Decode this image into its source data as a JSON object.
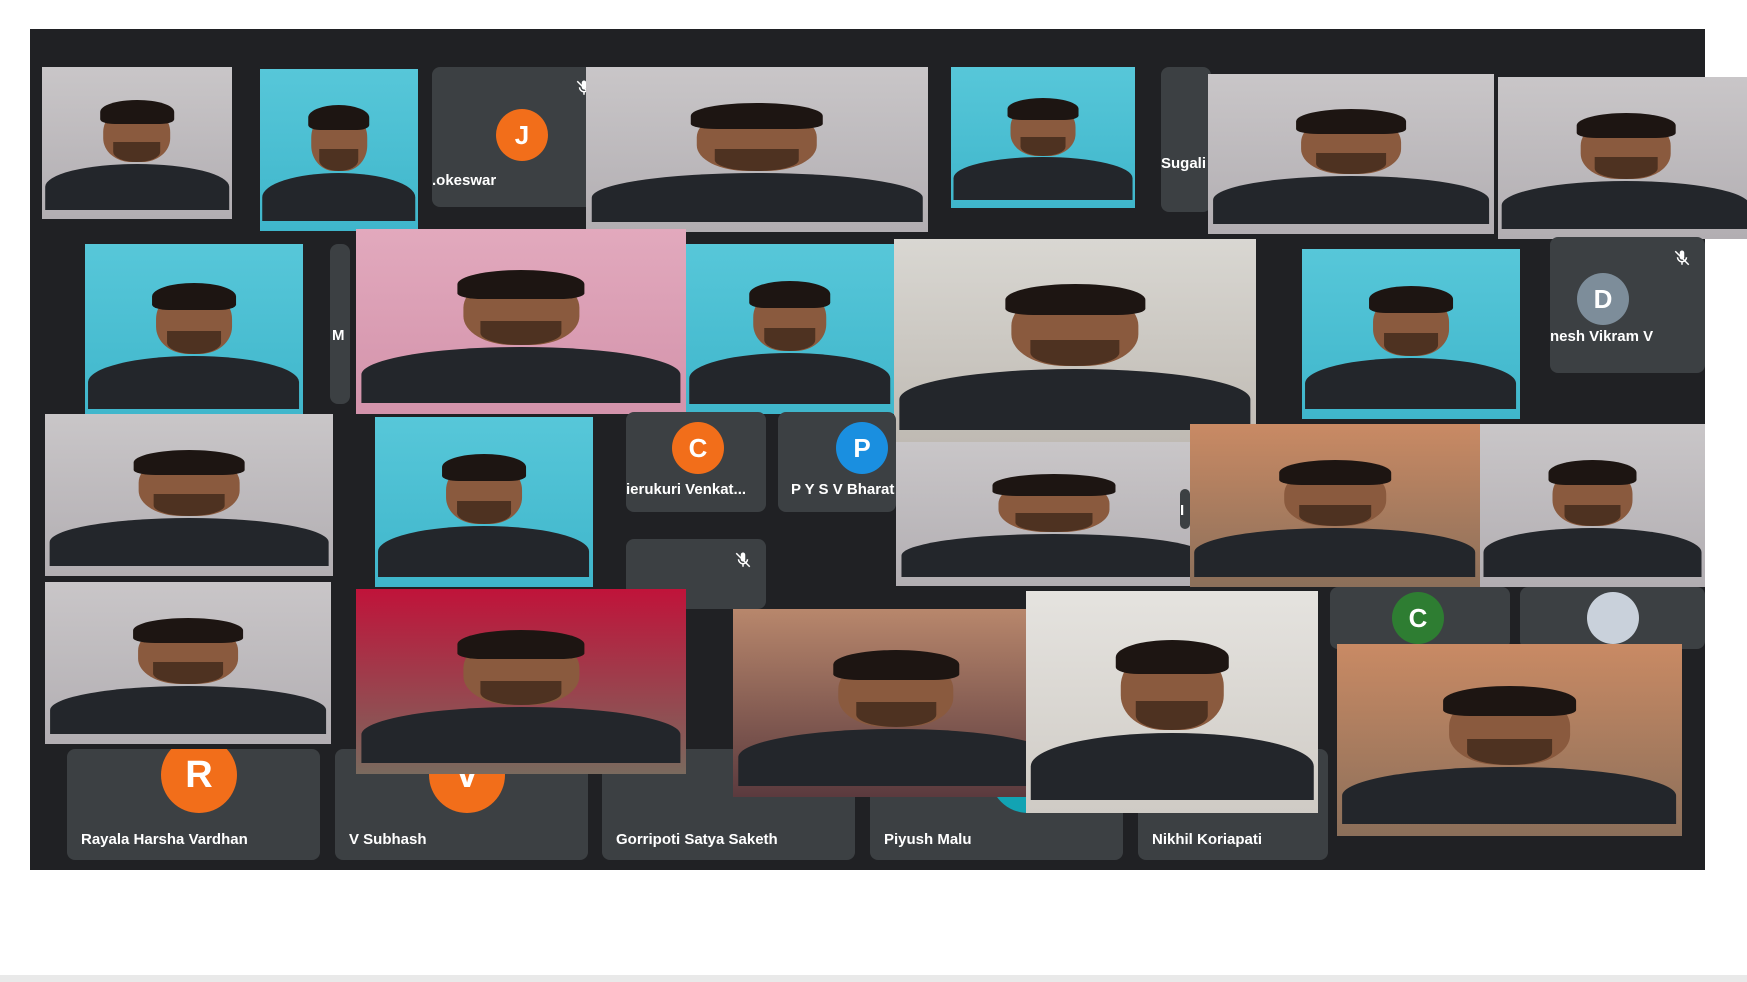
{
  "meeting": {
    "participants": [
      {
        "id": "p1",
        "name": "",
        "kind": "video",
        "theme": "wall"
      },
      {
        "id": "p2",
        "name": "",
        "kind": "video",
        "theme": "cyan"
      },
      {
        "id": "p3",
        "name": ".okeswar",
        "kind": "avatar",
        "initial": "J",
        "avatar_color": "#f26e1a",
        "muted": true
      },
      {
        "id": "p4",
        "name": "",
        "kind": "video",
        "theme": "wall"
      },
      {
        "id": "p5",
        "name": "",
        "kind": "video",
        "theme": "cyan"
      },
      {
        "id": "p6",
        "name": "Sugali",
        "kind": "label"
      },
      {
        "id": "p7",
        "name": "",
        "kind": "video",
        "theme": "wall"
      },
      {
        "id": "p8",
        "name": "",
        "kind": "video",
        "theme": "wall"
      },
      {
        "id": "p9",
        "name": "",
        "kind": "video",
        "theme": "cyan"
      },
      {
        "id": "p10",
        "name": "M",
        "kind": "label"
      },
      {
        "id": "p11",
        "name": "",
        "kind": "video",
        "theme": "pink"
      },
      {
        "id": "p12",
        "name": "",
        "kind": "video",
        "theme": "cyan"
      },
      {
        "id": "p13",
        "name": "",
        "kind": "video",
        "theme": "room"
      },
      {
        "id": "p14",
        "name": "",
        "kind": "video",
        "theme": "cyan"
      },
      {
        "id": "p15",
        "name": "nesh Vikram V",
        "kind": "avatar",
        "initial": "D",
        "avatar_color": "#7d8d9a",
        "muted": true
      },
      {
        "id": "p16",
        "name": "",
        "kind": "video",
        "theme": "wall"
      },
      {
        "id": "p17",
        "name": "",
        "kind": "video",
        "theme": "cyan"
      },
      {
        "id": "p18",
        "name": "ierukuri Venkat...",
        "kind": "avatar",
        "initial": "C",
        "avatar_color": "#f26e1a",
        "muted": false
      },
      {
        "id": "p19",
        "name": "P Y S V Bharat",
        "kind": "avatar",
        "initial": "P",
        "avatar_color": "#1a8fe0",
        "muted": false
      },
      {
        "id": "p20",
        "name": "",
        "kind": "video",
        "theme": "wall"
      },
      {
        "id": "p21",
        "name": "I",
        "kind": "label"
      },
      {
        "id": "p22",
        "name": "",
        "kind": "video",
        "theme": "bedroom"
      },
      {
        "id": "p23",
        "name": "",
        "kind": "video",
        "theme": "wall"
      },
      {
        "id": "p24",
        "name": "",
        "kind": "video",
        "theme": "wall"
      },
      {
        "id": "p25",
        "name": "",
        "kind": "video",
        "theme": "red"
      },
      {
        "id": "p26",
        "name": "",
        "kind": "video",
        "theme": "curtain"
      },
      {
        "id": "p27",
        "name": "",
        "kind": "video",
        "theme": "plain"
      },
      {
        "id": "p28",
        "name": "",
        "kind": "avatar",
        "initial": "C",
        "avatar_color": "#2e7d32",
        "muted": false
      },
      {
        "id": "p29",
        "name": "",
        "kind": "photo-avatar",
        "muted": false
      },
      {
        "id": "p30",
        "name": "",
        "kind": "video",
        "theme": "bedroom"
      }
    ],
    "bottom_row": [
      {
        "name": "Rayala Harsha Vardhan",
        "initial": "R",
        "avatar_color": "#f26e1a"
      },
      {
        "name": "V Subhash",
        "initial": "V",
        "avatar_color": "#f26e1a"
      },
      {
        "name": "Gorripoti Satya Saketh"
      },
      {
        "name": "Piyush Malu",
        "initial": "",
        "avatar_color": "#12a3b3"
      },
      {
        "name": "Nikhil Koriapati"
      }
    ]
  },
  "themes": {
    "wall": {
      "bg": "#c9c6c8",
      "accent": "#b2aeb2"
    },
    "cyan": {
      "bg": "#57c7d9",
      "accent": "#3fb6cb"
    },
    "pink": {
      "bg": "#e2a9bd",
      "accent": "#d393ab"
    },
    "room": {
      "bg": "#d9d7d2",
      "accent": "#bfbab3"
    },
    "bedroom": {
      "bg": "#c98a64",
      "accent": "#8b6f5a"
    },
    "red": {
      "bg": "#c0133a",
      "accent": "#7a6a5e"
    },
    "curtain": {
      "bg": "#b8876c",
      "accent": "#5b3a3e"
    },
    "plain": {
      "bg": "#e5e3df",
      "accent": "#cfcbc5"
    }
  }
}
